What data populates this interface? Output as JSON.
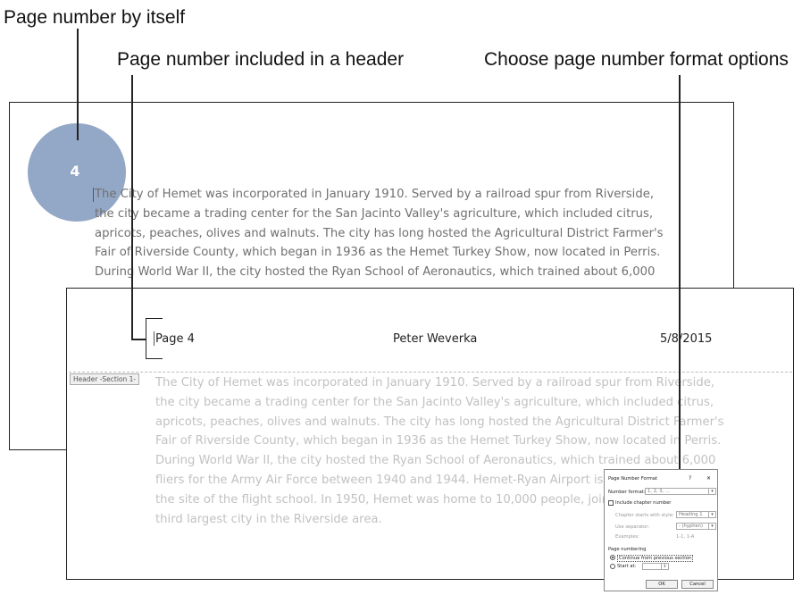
{
  "callouts": {
    "page_number_by_itself": "Page number by itself",
    "page_number_in_header": "Page number included in a header",
    "choose_format_options": "Choose page number format options"
  },
  "page_top": {
    "page_number": "4",
    "paragraph": [
      "The City of Hemet was incorporated in January 1910. Served by a railroad spur from Riverside,",
      "the city became a trading center for the San Jacinto Valley's agriculture, which included citrus,",
      "apricots, peaches, olives and walnuts. The city has long hosted the Agricultural District Farmer's",
      "Fair of Riverside County, which began in 1936 as the Hemet Turkey Show, now located in Perris.",
      "During World War II, the city hosted the Ryan School of Aeronautics, which trained about 6,000"
    ]
  },
  "page_bottom": {
    "header": {
      "left": "Page 4",
      "center": "Peter Weverka",
      "right": "5/8/2015"
    },
    "header_tag": "Header -Section 1-",
    "paragraph": [
      "The City of Hemet was incorporated in January 1910. Served by a railroad spur from Riverside,",
      "the city became a trading center for the San Jacinto Valley's agriculture, which included citrus,",
      "apricots, peaches, olives and walnuts. The city has long hosted the Agricultural District Farmer's",
      "Fair of Riverside County, which began in 1936 as the Hemet Turkey Show, now located in Perris.",
      "During World War II, the city hosted the Ryan School of Aeronautics, which trained about 6,000",
      "fliers for the Army Air Force between 1940 and 1944. Hemet-Ryan Airport is lo",
      "the site of the flight school. In 1950, Hemet was home to 10,000 people, joine",
      "third largest city in the Riverside area."
    ]
  },
  "dialog": {
    "title": "Page Number Format",
    "help": "?",
    "close": "✕",
    "number_format_label": "Number format:",
    "number_format_value": "1, 2, 3, ...",
    "include_chapter_label": "Include chapter number",
    "chapter_style_label": "Chapter starts with style:",
    "chapter_style_value": "Heading 1",
    "separator_label": "Use separator:",
    "separator_value": "-   (hyphen)",
    "examples_label": "Examples:",
    "examples_value": "1-1, 1-A",
    "page_numbering_label": "Page numbering",
    "continue_label": "Continue from previous section",
    "start_at_label": "Start at:",
    "ok": "OK",
    "cancel": "Cancel"
  },
  "colors": {
    "circle": "#93a7c6",
    "top_text": "#707070",
    "bottom_text": "#c2c2c2"
  }
}
